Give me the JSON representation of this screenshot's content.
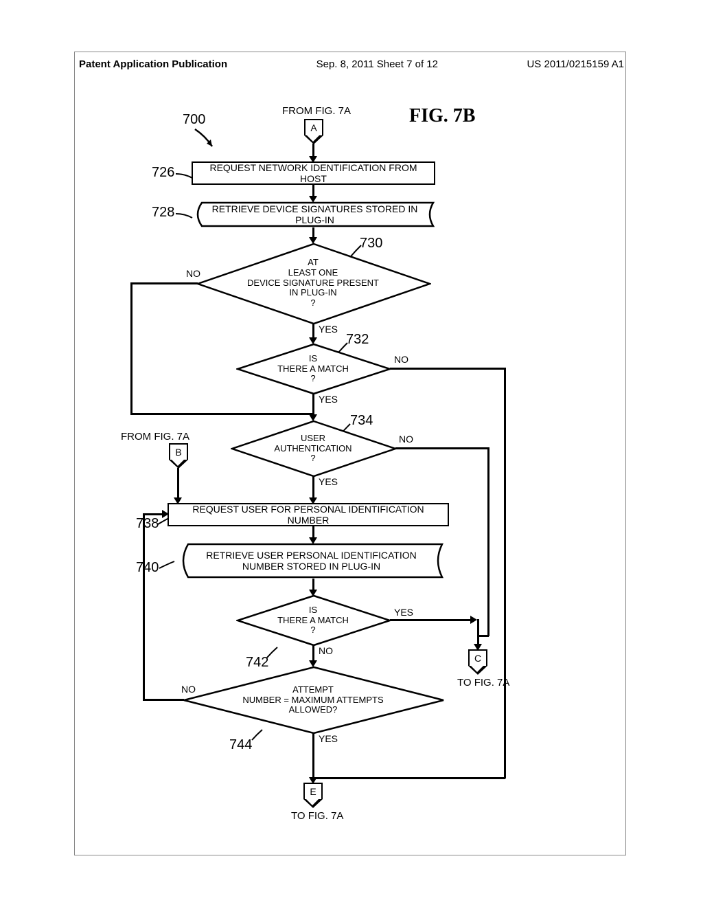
{
  "header": {
    "left": "Patent Application Publication",
    "center": "Sep. 8, 2011   Sheet 7 of 12",
    "right": "US 2011/0215159 A1"
  },
  "figure_title": "FIG. 7B",
  "from_a": "FROM FIG. 7A",
  "from_b": "FROM FIG. 7A",
  "to_c": "TO FIG. 7A",
  "to_e": "TO FIG. 7A",
  "refs": {
    "r700": "700",
    "r726": "726",
    "r728": "728",
    "r730": "730",
    "r732": "732",
    "r734": "734",
    "r738": "738",
    "r740": "740",
    "r742": "742",
    "r744": "744"
  },
  "connectors": {
    "A": "A",
    "B": "B",
    "C": "C",
    "E": "E"
  },
  "boxes": {
    "b726": "REQUEST NETWORK IDENTIFICATION FROM HOST",
    "b728": "RETRIEVE DEVICE SIGNATURES STORED IN PLUG-IN",
    "b738": "REQUEST USER FOR PERSONAL IDENTIFICATION NUMBER",
    "b740": "RETRIEVE USER PERSONAL IDENTIFICATION\nNUMBER STORED IN PLUG-IN"
  },
  "decisions": {
    "d730": "AT\nLEAST ONE\nDEVICE SIGNATURE PRESENT\nIN PLUG-IN\n?",
    "d732": "IS\nTHERE A MATCH\n?",
    "d734": "USER\nAUTHENTICATION\n?",
    "d742": "IS\nTHERE A MATCH\n?",
    "d744": "ATTEMPT\nNUMBER = MAXIMUM ATTEMPTS\nALLOWED?"
  },
  "branches": {
    "yes": "YES",
    "no": "NO"
  }
}
